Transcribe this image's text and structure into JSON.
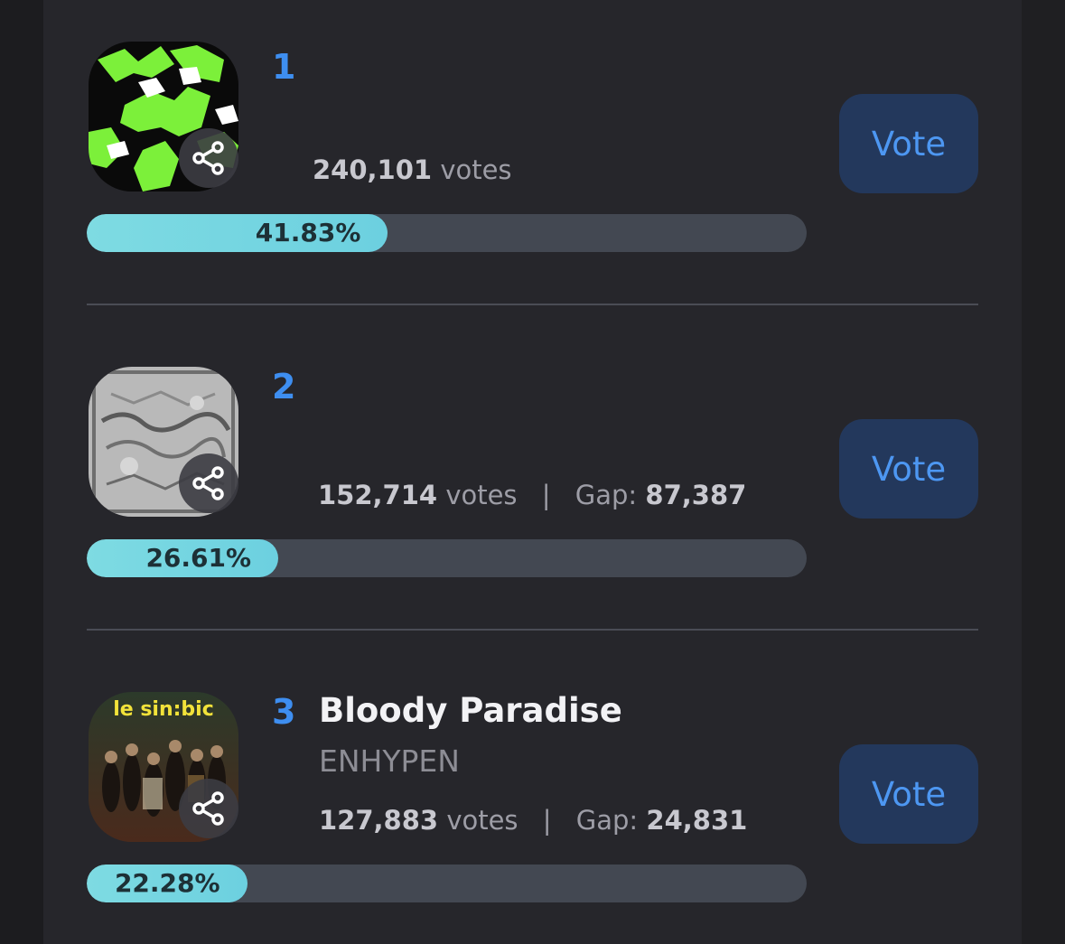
{
  "entries": [
    {
      "rank": "1",
      "title": "",
      "artist": "",
      "votes": "240,101",
      "votes_unit": "votes",
      "gap_label": "",
      "gap": "",
      "percent_label": "41.83%",
      "percent": 41.83,
      "vote_label": "Vote",
      "share_icon": "share-icon"
    },
    {
      "rank": "2",
      "title": "",
      "artist": "",
      "votes": "152,714",
      "votes_unit": "votes",
      "gap_label": "Gap:",
      "gap": "87,387",
      "percent_label": "26.61%",
      "percent": 26.61,
      "vote_label": "Vote",
      "share_icon": "share-icon"
    },
    {
      "rank": "3",
      "title": "Bloody Paradise",
      "artist": "ENHYPEN",
      "votes": "127,883",
      "votes_unit": "votes",
      "gap_label": "Gap:",
      "gap": "24,831",
      "percent_label": "22.28%",
      "percent": 22.28,
      "vote_label": "Vote",
      "share_icon": "share-icon"
    }
  ],
  "cover_text": {
    "entry3": "le sin:bic"
  },
  "colors": {
    "accent_blue": "#3e8ef0",
    "bar_fill": "#6cd0e0",
    "bar_track": "#434852",
    "vote_button_bg": "#23385c"
  }
}
